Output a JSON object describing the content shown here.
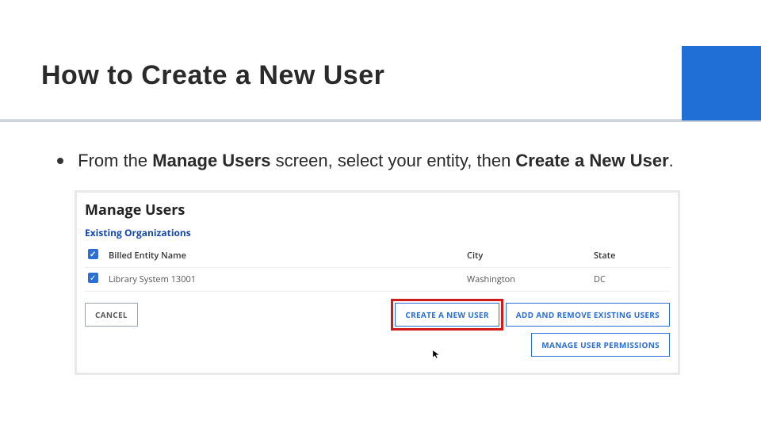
{
  "slide": {
    "title": "How to Create a New User",
    "bullet": {
      "prefix": "From the ",
      "bold1": "Manage Users",
      "mid": " screen, select your entity, then ",
      "bold2": "Create a New User",
      "suffix": "."
    }
  },
  "panel": {
    "title": "Manage Users",
    "subhead": "Existing Organizations",
    "columns": {
      "c0": "",
      "c1": "Billed Entity Name",
      "c2": "City",
      "c3": "State"
    },
    "row": {
      "name": "Library System 13001",
      "city": "Washington",
      "state": "DC"
    },
    "buttons": {
      "cancel": "CANCEL",
      "create": "CREATE A NEW USER",
      "addremove": "ADD AND REMOVE EXISTING USERS",
      "manage": "MANAGE USER PERMISSIONS"
    }
  },
  "colors": {
    "accent": "#1f6fd6",
    "highlight": "#d11a1a"
  }
}
